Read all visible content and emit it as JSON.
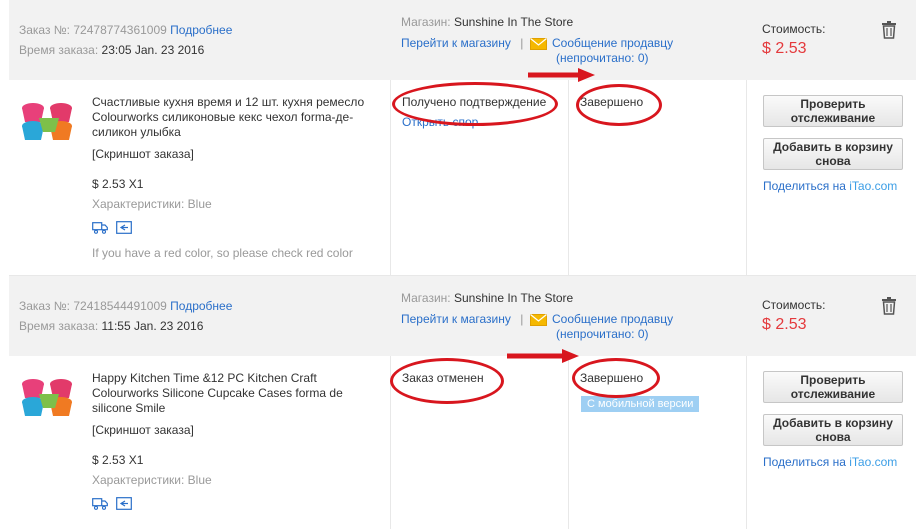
{
  "labels": {
    "order_no": "Заказ №:",
    "order_time": "Время заказа:",
    "details_link": "Подробнее",
    "store": "Магазин:",
    "go_to_store": "Перейти к магазину",
    "separator": "|",
    "message_seller": "Сообщение продавцу",
    "unread": "(непрочитано: 0)",
    "cost": "Стоимость:",
    "screenshot": "[Скриншот заказа]",
    "characteristics_label": "Характеристики:",
    "track_button": "Проверить отслеживание",
    "add_cart_button": "Добавить в корзину снова",
    "share_prefix": "Поделиться на ",
    "share_site": "iTao.com"
  },
  "orders": [
    {
      "number": "72478774361009",
      "time": "23:05 Jan. 23 2016",
      "store_name": "Sunshine In The Store",
      "cost": "$ 2.53",
      "product_title": "Счастливые кухня время и 12 шт. кухня ремесло Colourworks силиконовые кекс чехол forma-де-силикон улыбка",
      "price_qty": "$ 2.53 X1",
      "characteristics_value": "Blue",
      "buyer_note": "If you have a red color, so please check red color",
      "status_main": "Получено подтверждение",
      "status_sub": "Открыть спор",
      "status_final": "Завершено"
    },
    {
      "number": "72418544491009",
      "time": "11:55 Jan. 23 2016",
      "store_name": "Sunshine In The Store",
      "cost": "$ 2.53",
      "product_title": "Happy Kitchen Time &12 PC Kitchen Craft Colourworks Silicone Cupcake Cases forma de silicone Smile",
      "price_qty": "$ 2.53 X1",
      "characteristics_value": "Blue",
      "status_main": "Заказ отменен",
      "status_final": "Завершено",
      "mobile_badge": "С мобильной версии"
    }
  ],
  "colors": {
    "link": "#2a6fc9",
    "price": "#e4393c",
    "annotation": "#d8161e",
    "header_bg": "#f2f2f2"
  },
  "icons": [
    "trash-icon",
    "envelope-icon",
    "truck-icon",
    "receipt-icon",
    "arrow-right-icon"
  ]
}
